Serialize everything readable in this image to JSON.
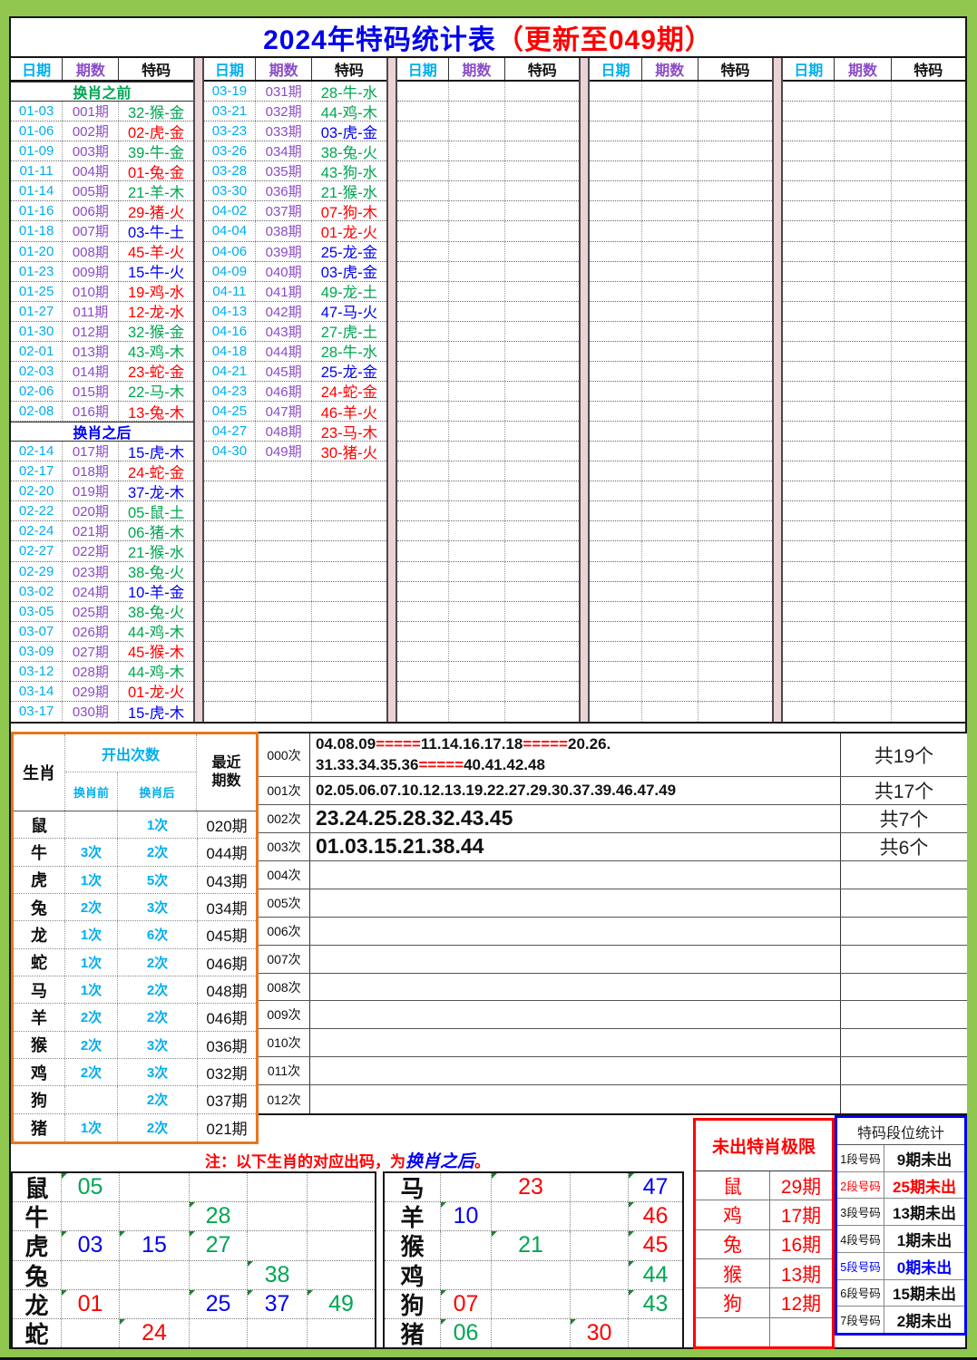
{
  "title": {
    "main": "2024年特码统计表",
    "suffix": "（更新至049期）"
  },
  "main_table": {
    "headers": {
      "date": "日期",
      "period": "期数",
      "code": "特码"
    },
    "columns": [
      {
        "rows": [
          {
            "type": "sub",
            "label": "换肖之前",
            "color": "green"
          },
          {
            "type": "data",
            "date": "01-03",
            "period": "001期",
            "code": "32-猴-金",
            "color": "green"
          },
          {
            "type": "data",
            "date": "01-06",
            "period": "002期",
            "code": "02-虎-金",
            "color": "red"
          },
          {
            "type": "data",
            "date": "01-09",
            "period": "003期",
            "code": "39-牛-金",
            "color": "green"
          },
          {
            "type": "data",
            "date": "01-11",
            "period": "004期",
            "code": "01-兔-金",
            "color": "red"
          },
          {
            "type": "data",
            "date": "01-14",
            "period": "005期",
            "code": "21-羊-木",
            "color": "green"
          },
          {
            "type": "data",
            "date": "01-16",
            "period": "006期",
            "code": "29-猪-火",
            "color": "red"
          },
          {
            "type": "data",
            "date": "01-18",
            "period": "007期",
            "code": "03-牛-土",
            "color": "blue"
          },
          {
            "type": "data",
            "date": "01-20",
            "period": "008期",
            "code": "45-羊-火",
            "color": "red"
          },
          {
            "type": "data",
            "date": "01-23",
            "period": "009期",
            "code": "15-牛-火",
            "color": "blue"
          },
          {
            "type": "data",
            "date": "01-25",
            "period": "010期",
            "code": "19-鸡-水",
            "color": "red"
          },
          {
            "type": "data",
            "date": "01-27",
            "period": "011期",
            "code": "12-龙-水",
            "color": "red"
          },
          {
            "type": "data",
            "date": "01-30",
            "period": "012期",
            "code": "32-猴-金",
            "color": "green"
          },
          {
            "type": "data",
            "date": "02-01",
            "period": "013期",
            "code": "43-鸡-木",
            "color": "green"
          },
          {
            "type": "data",
            "date": "02-03",
            "period": "014期",
            "code": "23-蛇-金",
            "color": "red"
          },
          {
            "type": "data",
            "date": "02-06",
            "period": "015期",
            "code": "22-马-木",
            "color": "green"
          },
          {
            "type": "data",
            "date": "02-08",
            "period": "016期",
            "code": "13-兔-木",
            "color": "red"
          },
          {
            "type": "sub",
            "label": "换肖之后",
            "color": "blue"
          },
          {
            "type": "data",
            "date": "02-14",
            "period": "017期",
            "code": "15-虎-木",
            "color": "blue"
          },
          {
            "type": "data",
            "date": "02-17",
            "period": "018期",
            "code": "24-蛇-金",
            "color": "red"
          },
          {
            "type": "data",
            "date": "02-20",
            "period": "019期",
            "code": "37-龙-木",
            "color": "blue"
          },
          {
            "type": "data",
            "date": "02-22",
            "period": "020期",
            "code": "05-鼠-土",
            "color": "green"
          },
          {
            "type": "data",
            "date": "02-24",
            "period": "021期",
            "code": "06-猪-木",
            "color": "green"
          },
          {
            "type": "data",
            "date": "02-27",
            "period": "022期",
            "code": "21-猴-水",
            "color": "green"
          },
          {
            "type": "data",
            "date": "02-29",
            "period": "023期",
            "code": "38-兔-火",
            "color": "green"
          },
          {
            "type": "data",
            "date": "03-02",
            "period": "024期",
            "code": "10-羊-金",
            "color": "blue"
          },
          {
            "type": "data",
            "date": "03-05",
            "period": "025期",
            "code": "38-兔-火",
            "color": "green"
          },
          {
            "type": "data",
            "date": "03-07",
            "period": "026期",
            "code": "44-鸡-木",
            "color": "green"
          },
          {
            "type": "data",
            "date": "03-09",
            "period": "027期",
            "code": "45-猴-木",
            "color": "red"
          },
          {
            "type": "data",
            "date": "03-12",
            "period": "028期",
            "code": "44-鸡-木",
            "color": "green"
          },
          {
            "type": "data",
            "date": "03-14",
            "period": "029期",
            "code": "01-龙-火",
            "color": "red"
          },
          {
            "type": "data",
            "date": "03-17",
            "period": "030期",
            "code": "15-虎-木",
            "color": "blue"
          }
        ]
      },
      {
        "rows": [
          {
            "type": "data",
            "date": "03-19",
            "period": "031期",
            "code": "28-牛-水",
            "color": "green"
          },
          {
            "type": "data",
            "date": "03-21",
            "period": "032期",
            "code": "44-鸡-木",
            "color": "green"
          },
          {
            "type": "data",
            "date": "03-23",
            "period": "033期",
            "code": "03-虎-金",
            "color": "blue"
          },
          {
            "type": "data",
            "date": "03-26",
            "period": "034期",
            "code": "38-兔-火",
            "color": "green"
          },
          {
            "type": "data",
            "date": "03-28",
            "period": "035期",
            "code": "43-狗-水",
            "color": "green"
          },
          {
            "type": "data",
            "date": "03-30",
            "period": "036期",
            "code": "21-猴-水",
            "color": "green"
          },
          {
            "type": "data",
            "date": "04-02",
            "period": "037期",
            "code": "07-狗-木",
            "color": "red"
          },
          {
            "type": "data",
            "date": "04-04",
            "period": "038期",
            "code": "01-龙-火",
            "color": "red"
          },
          {
            "type": "data",
            "date": "04-06",
            "period": "039期",
            "code": "25-龙-金",
            "color": "blue"
          },
          {
            "type": "data",
            "date": "04-09",
            "period": "040期",
            "code": "03-虎-金",
            "color": "blue"
          },
          {
            "type": "data",
            "date": "04-11",
            "period": "041期",
            "code": "49-龙-土",
            "color": "green"
          },
          {
            "type": "data",
            "date": "04-13",
            "period": "042期",
            "code": "47-马-火",
            "color": "blue"
          },
          {
            "type": "data",
            "date": "04-16",
            "period": "043期",
            "code": "27-虎-土",
            "color": "green"
          },
          {
            "type": "data",
            "date": "04-18",
            "period": "044期",
            "code": "28-牛-水",
            "color": "green"
          },
          {
            "type": "data",
            "date": "04-21",
            "period": "045期",
            "code": "25-龙-金",
            "color": "blue"
          },
          {
            "type": "data",
            "date": "04-23",
            "period": "046期",
            "code": "24-蛇-金",
            "color": "red"
          },
          {
            "type": "data",
            "date": "04-25",
            "period": "047期",
            "code": "46-羊-火",
            "color": "red"
          },
          {
            "type": "data",
            "date": "04-27",
            "period": "048期",
            "code": "23-马-木",
            "color": "red"
          },
          {
            "type": "data",
            "date": "04-30",
            "period": "049期",
            "code": "30-猪-火",
            "color": "red"
          }
        ]
      },
      {
        "rows": []
      },
      {
        "rows": []
      },
      {
        "rows": []
      }
    ]
  },
  "zodiac_stats": {
    "header": {
      "zodiac": "生肖",
      "count": "开出次数",
      "before": "换肖前",
      "after": "换肖后",
      "recent": "最近期数"
    },
    "rows": [
      {
        "zodiac": "鼠",
        "before": "",
        "after": "1次",
        "recent": "020期"
      },
      {
        "zodiac": "牛",
        "before": "3次",
        "after": "2次",
        "recent": "044期"
      },
      {
        "zodiac": "虎",
        "before": "1次",
        "after": "5次",
        "recent": "043期"
      },
      {
        "zodiac": "兔",
        "before": "2次",
        "after": "3次",
        "recent": "034期"
      },
      {
        "zodiac": "龙",
        "before": "1次",
        "after": "6次",
        "recent": "045期"
      },
      {
        "zodiac": "蛇",
        "before": "1次",
        "after": "2次",
        "recent": "046期"
      },
      {
        "zodiac": "马",
        "before": "1次",
        "after": "2次",
        "recent": "048期"
      },
      {
        "zodiac": "羊",
        "before": "2次",
        "after": "2次",
        "recent": "046期"
      },
      {
        "zodiac": "猴",
        "before": "2次",
        "after": "3次",
        "recent": "036期"
      },
      {
        "zodiac": "鸡",
        "before": "2次",
        "after": "3次",
        "recent": "032期"
      },
      {
        "zodiac": "狗",
        "before": "",
        "after": "2次",
        "recent": "037期"
      },
      {
        "zodiac": "猪",
        "before": "1次",
        "after": "2次",
        "recent": "021期"
      }
    ]
  },
  "frequency": {
    "rows": [
      {
        "label": "000次",
        "size": "small",
        "tall": true,
        "count": "共19个",
        "parts": [
          {
            "t": "04.08.09"
          },
          {
            "t": "=====",
            "red": true
          },
          {
            "t": "11.14.16.17.18"
          },
          {
            "t": "=====",
            "red": true
          },
          {
            "t": "20.26."
          },
          {
            "br": true
          },
          {
            "t": "31.33.34.35.36"
          },
          {
            "t": "=====",
            "red": true
          },
          {
            "t": "40.41.42.48"
          }
        ]
      },
      {
        "label": "001次",
        "size": "small",
        "count": "共17个",
        "parts": [
          {
            "t": "02.05.06.07.10.12.13.19.22.27.29.30.37.39.46.47.49"
          }
        ]
      },
      {
        "label": "002次",
        "size": "large",
        "count": "共7个",
        "parts": [
          {
            "t": "23.24.25.28.32.43.45"
          }
        ]
      },
      {
        "label": "003次",
        "size": "large",
        "count": "共6个",
        "parts": [
          {
            "t": "01.03.15.21.38.44"
          }
        ]
      },
      {
        "label": "004次",
        "size": "small",
        "count": "",
        "parts": []
      },
      {
        "label": "005次",
        "size": "small",
        "count": "",
        "parts": []
      },
      {
        "label": "006次",
        "size": "small",
        "count": "",
        "parts": []
      },
      {
        "label": "007次",
        "size": "small",
        "count": "",
        "parts": []
      },
      {
        "label": "008次",
        "size": "small",
        "count": "",
        "parts": []
      },
      {
        "label": "009次",
        "size": "small",
        "count": "",
        "parts": []
      },
      {
        "label": "010次",
        "size": "small",
        "count": "",
        "parts": []
      },
      {
        "label": "011次",
        "size": "small",
        "count": "",
        "parts": []
      },
      {
        "label": "012次",
        "size": "small",
        "count": "",
        "parts": []
      }
    ]
  },
  "note": {
    "parts": [
      {
        "t": "注：以下生肖的对应出码，为",
        "c": "red"
      },
      {
        "t": "换肖之后",
        "c": "blue"
      },
      {
        "t": "。",
        "c": "red"
      }
    ]
  },
  "bottom_left": {
    "columns": 5,
    "rows": [
      {
        "zodiac": "鼠",
        "cells": [
          {
            "col": 0,
            "v": "05",
            "c": "green"
          }
        ]
      },
      {
        "zodiac": "牛",
        "cells": [
          {
            "col": 2,
            "v": "28",
            "c": "green"
          }
        ]
      },
      {
        "zodiac": "虎",
        "cells": [
          {
            "col": 0,
            "v": "03",
            "c": "blue"
          },
          {
            "col": 1,
            "v": "15",
            "c": "blue"
          },
          {
            "col": 2,
            "v": "27",
            "c": "green"
          }
        ]
      },
      {
        "zodiac": "兔",
        "cells": [
          {
            "col": 3,
            "v": "38",
            "c": "green"
          }
        ]
      },
      {
        "zodiac": "龙",
        "cells": [
          {
            "col": 0,
            "v": "01",
            "c": "red"
          },
          {
            "col": 2,
            "v": "25",
            "c": "blue"
          },
          {
            "col": 3,
            "v": "37",
            "c": "blue"
          },
          {
            "col": 4,
            "v": "49",
            "c": "green"
          }
        ]
      },
      {
        "zodiac": "蛇",
        "cells": [
          {
            "col": 1,
            "v": "24",
            "c": "red"
          }
        ]
      }
    ]
  },
  "bottom_right": {
    "columns": 4,
    "rows": [
      {
        "zodiac": "马",
        "cells": [
          {
            "col": 1,
            "v": "23",
            "c": "red"
          },
          {
            "col": 3,
            "v": "47",
            "c": "blue"
          }
        ]
      },
      {
        "zodiac": "羊",
        "cells": [
          {
            "col": 0,
            "v": "10",
            "c": "blue"
          },
          {
            "col": 3,
            "v": "46",
            "c": "red"
          }
        ]
      },
      {
        "zodiac": "猴",
        "cells": [
          {
            "col": 1,
            "v": "21",
            "c": "green"
          },
          {
            "col": 3,
            "v": "45",
            "c": "red"
          }
        ]
      },
      {
        "zodiac": "鸡",
        "cells": [
          {
            "col": 3,
            "v": "44",
            "c": "green"
          }
        ]
      },
      {
        "zodiac": "狗",
        "cells": [
          {
            "col": 0,
            "v": "07",
            "c": "red"
          },
          {
            "col": 3,
            "v": "43",
            "c": "green"
          }
        ]
      },
      {
        "zodiac": "猪",
        "cells": [
          {
            "col": 0,
            "v": "06",
            "c": "green"
          },
          {
            "col": 2,
            "v": "30",
            "c": "red"
          }
        ]
      }
    ]
  },
  "missing_zodiac": {
    "title": "未出特肖极限",
    "rows": [
      {
        "zodiac": "鼠",
        "periods": "29期"
      },
      {
        "zodiac": "鸡",
        "periods": "17期"
      },
      {
        "zodiac": "兔",
        "periods": "16期"
      },
      {
        "zodiac": "猴",
        "periods": "13期"
      },
      {
        "zodiac": "狗",
        "periods": "12期"
      },
      {
        "zodiac": "",
        "periods": ""
      }
    ]
  },
  "segment_stats": {
    "title": "特码段位统计",
    "rows": [
      {
        "label": "1段号码",
        "value": "9期未出",
        "color": "black"
      },
      {
        "label": "2段号码",
        "value": "25期未出",
        "color": "red"
      },
      {
        "label": "3段号码",
        "value": "13期未出",
        "color": "black"
      },
      {
        "label": "4段号码",
        "value": "1期未出",
        "color": "black"
      },
      {
        "label": "5段号码",
        "value": "0期未出",
        "color": "blue"
      },
      {
        "label": "6段号码",
        "value": "15期未出",
        "color": "black"
      },
      {
        "label": "7段号码",
        "value": "2期未出",
        "color": "black"
      }
    ]
  },
  "colors": {
    "red": "#FE0000",
    "blue": "#0000F5",
    "green": "#00A651",
    "cyan": "#00AEEF",
    "purple": "#8B4BC8",
    "frame_green": "#8FC74E",
    "separator_pink": "#EBD3D5",
    "orange_border": "#E8761E"
  }
}
